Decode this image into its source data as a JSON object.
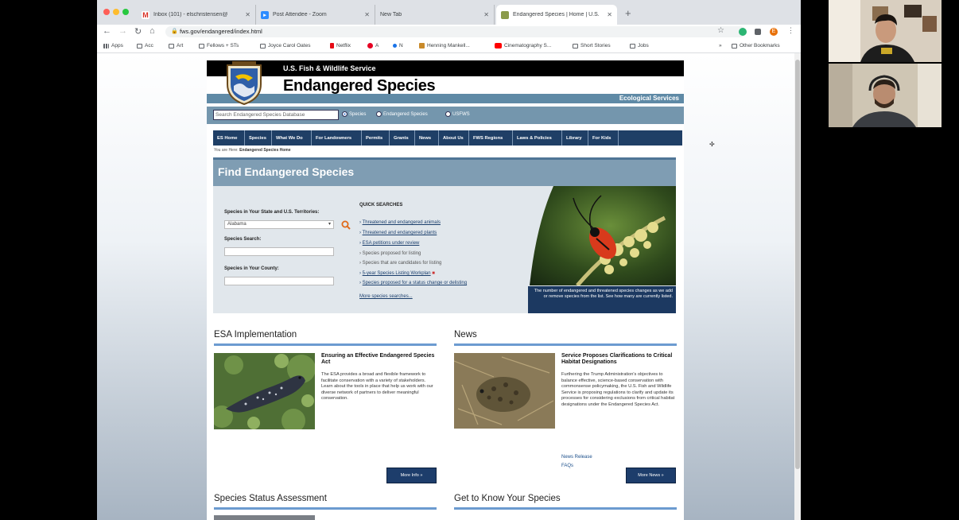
{
  "browser": {
    "tabs": [
      {
        "title": "Inbox (101) - elschristensen@",
        "favicon": "gmail"
      },
      {
        "title": "Post Attendee - Zoom",
        "favicon": "zoom"
      },
      {
        "title": "New Tab",
        "favicon": "none"
      },
      {
        "title": "Endangered Species | Home | U.S.",
        "favicon": "fws"
      }
    ],
    "new_tab_label": "+",
    "url": "fws.gov/endangered/index.html",
    "profile_initial": "E",
    "bookmarks": [
      "Apps",
      "Acc",
      "Art",
      "Fellows + STs",
      "Joyce Carol Oates",
      "Netflix",
      "A",
      "N",
      "Henning Mankell...",
      "Cinematography S...",
      "Short Stories",
      "Jobs"
    ],
    "other_bookmarks": "Other Bookmarks",
    "more_bookmarks": "»"
  },
  "site": {
    "agency": "U.S. Fish & Wildlife Service",
    "title": "Endangered Species",
    "subtitle": "Ecological Services",
    "search_placeholder": "Search Endangered Species Database",
    "search_scopes": [
      "Species",
      "Endangered Species",
      "USFWS"
    ],
    "nav": [
      "ES Home",
      "Species",
      "What We Do",
      "For Landowners",
      "Permits",
      "Grants",
      "News",
      "About Us",
      "FWS Regions",
      "Laws & Policies",
      "Library",
      "For Kids"
    ],
    "breadcrumb_prefix": "You are Here:",
    "breadcrumb_current": "Endangered Species Home",
    "find": {
      "title": "Find Endangered Species",
      "state_label": "Species in Your State and U.S. Territories:",
      "state_value": "Alabama",
      "search_label": "Species Search:",
      "county_label": "Species in Your County:",
      "quick_title": "QUICK SEARCHES",
      "quick_links": [
        "Threatened and endangered animals",
        "Threatened and endangered plants",
        "ESA petitions under review",
        "Species proposed for listing",
        "Species that are candidates for listing",
        "5-year Species Listing Workplan",
        "Species proposed for a status change or delisting"
      ],
      "more_link": "More species searches...",
      "caption": "The number of endangered and threatened species changes as we add or remove species from the list. See how many are currently listed."
    },
    "esa": {
      "heading": "ESA Implementation",
      "title": "Ensuring an Effective Endangered Species Act",
      "body": "The ESA provides a broad and flexible framework to facilitate conservation with a variety of stakeholders. Learn about the tools in place that help us work with our diverse network of partners to deliver meaningful conservation.",
      "button": "More Info »"
    },
    "news": {
      "heading": "News",
      "title": "Service Proposes Clarifications to Critical Habitat Designations",
      "body": "Furthering the Trump Administration's objectives to balance effective, science-based conservation with commonsense policymaking, the U.S. Fish and Wildlife Service is proposing regulations to clarify and update its processes for considering exclusions from critical habitat designations under the Endangered Species Act.",
      "links": [
        "News Release",
        "FAQs"
      ],
      "button": "More News »"
    },
    "bottom_headings": [
      "Species Status Assessment",
      "Get to Know Your Species"
    ]
  }
}
